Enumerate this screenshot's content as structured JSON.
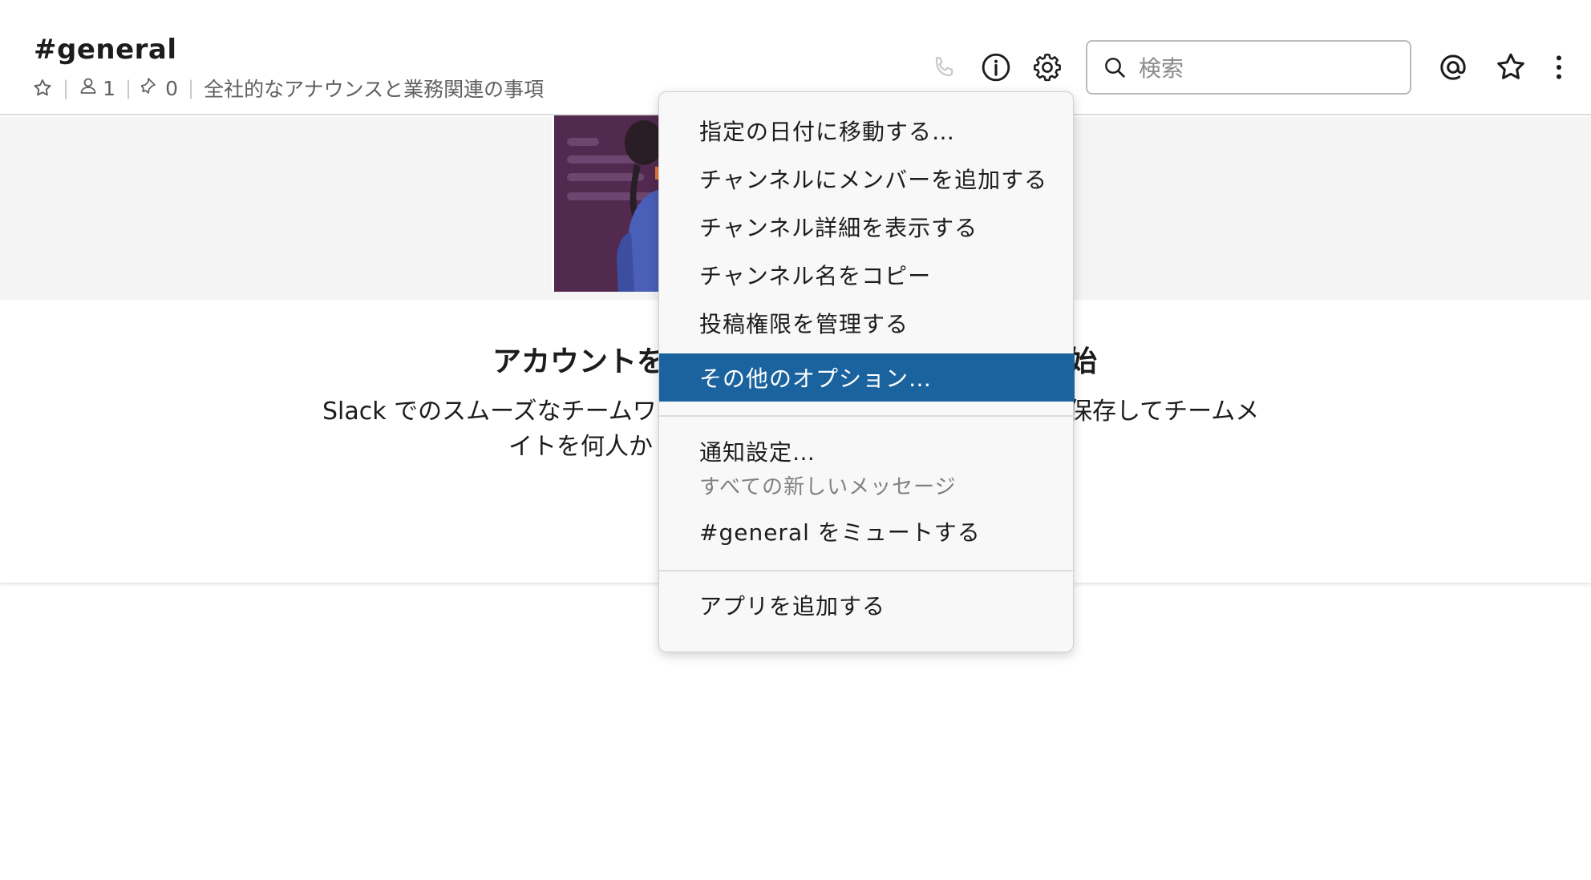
{
  "header": {
    "channel_name": "#general",
    "member_count": "1",
    "pinned_count": "0",
    "topic": "全社的なアナウンスと業務関連の事項",
    "search_placeholder": "検索"
  },
  "panel": {
    "title_left": "アカウントを",
    "title_right": "始",
    "body_line1_left": "Slack でのスムーズなチームワー",
    "body_line1_right": "保存してチームメ",
    "body_line2_left": "イトを何人か"
  },
  "menu": {
    "items": [
      {
        "label": "指定の日付に移動する…"
      },
      {
        "label": "チャンネルにメンバーを追加する"
      },
      {
        "label": "チャンネル詳細を表示する"
      },
      {
        "label": "チャンネル名をコピー"
      },
      {
        "label": "投稿権限を管理する"
      },
      {
        "label": "その他のオプション…"
      }
    ],
    "notifications": {
      "label": "通知設定…",
      "sub": "すべての新しいメッセージ"
    },
    "mute_label": "#general をミュートする",
    "add_apps_label": "アプリを追加する",
    "active_color": "#1b639f"
  },
  "icons": {
    "star": "star-icon",
    "member": "person-icon",
    "pin": "pin-icon",
    "call": "phone-icon",
    "info": "info-icon",
    "settings": "gear-icon",
    "search": "search-icon",
    "mentions": "at-icon",
    "starred": "star-outline-icon",
    "more": "vertical-ellipsis-icon"
  }
}
